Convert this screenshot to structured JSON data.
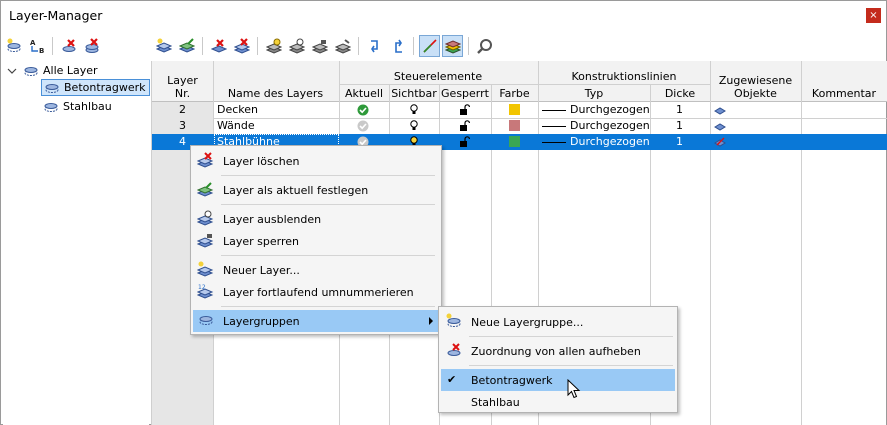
{
  "window": {
    "title": "Layer-Manager",
    "close": "×"
  },
  "toolbar_left": [
    "new-layer-group-icon",
    "rename-ab-icon",
    "delete-group-icon",
    "delete-all-groups-icon"
  ],
  "toolbar_right": [
    "new-layer-icon",
    "set-current-icon",
    "delete-layer-icon",
    "delete-all-layers-icon",
    "hide-layer-icon",
    "show-layer-icon",
    "lock-layer-icon",
    "unlock-layer-icon",
    "undo-icon",
    "redo-icon",
    "line-color-icon",
    "layer-stack-icon",
    "zoom-icon"
  ],
  "tree": {
    "root": "Alle Layer",
    "items": [
      "Betontragwerk",
      "Stahlbau"
    ]
  },
  "table": {
    "headers": {
      "nr_top": "Layer",
      "nr_bottom": "Nr.",
      "name": "Name des Layers",
      "controls_group": "Steuerelemente",
      "aktuell": "Aktuell",
      "sichtbar": "Sichtbar",
      "gesperrt": "Gesperrt",
      "farbe": "Farbe",
      "constr_group": "Konstruktionslinien",
      "typ": "Typ",
      "dicke": "Dicke",
      "assigned_top": "Zugewiesene",
      "assigned_bottom": "Objekte",
      "kommentar": "Kommentar"
    },
    "rows": [
      {
        "nr": "2",
        "name": "Decken",
        "color": "#f2c500",
        "typ": "Durchgezogen",
        "dicke": "1",
        "current": true
      },
      {
        "nr": "3",
        "name": "Wände",
        "color": "#c8787a",
        "typ": "Durchgezogen",
        "dicke": "1",
        "current": false
      },
      {
        "nr": "4",
        "name": "Stahlbühne",
        "color": "#3aa655",
        "typ": "Durchgezogen",
        "dicke": "1",
        "current": false
      }
    ]
  },
  "context_menu": {
    "items": [
      {
        "label": "Layer löschen",
        "icon": "delete-layer-icon"
      },
      {
        "label": "Layer als aktuell festlegen",
        "icon": "set-current-icon"
      },
      {
        "label": "Layer ausblenden",
        "icon": "hide-layer-icon"
      },
      {
        "label": "Layer sperren",
        "icon": "lock-layer-icon"
      },
      {
        "label": "Neuer Layer...",
        "icon": "new-layer-icon"
      },
      {
        "label": "Layer fortlaufend umnummerieren",
        "icon": "renumber-icon"
      },
      {
        "label": "Layergruppen",
        "icon": "layer-groups-icon"
      }
    ]
  },
  "submenu": {
    "items": [
      {
        "label": "Neue Layergruppe...",
        "icon": "new-layer-group-icon"
      },
      {
        "label": "Zuordnung von allen aufheben",
        "icon": "remove-assignment-icon"
      },
      {
        "label": "Betontragwerk",
        "checked": true
      },
      {
        "label": "Stahlbau",
        "checked": false
      }
    ],
    "check_mark": "✔"
  },
  "colors": {
    "selection": "#0a78d7",
    "menu_highlight": "#99c9f5",
    "close": "#c42b1c"
  }
}
